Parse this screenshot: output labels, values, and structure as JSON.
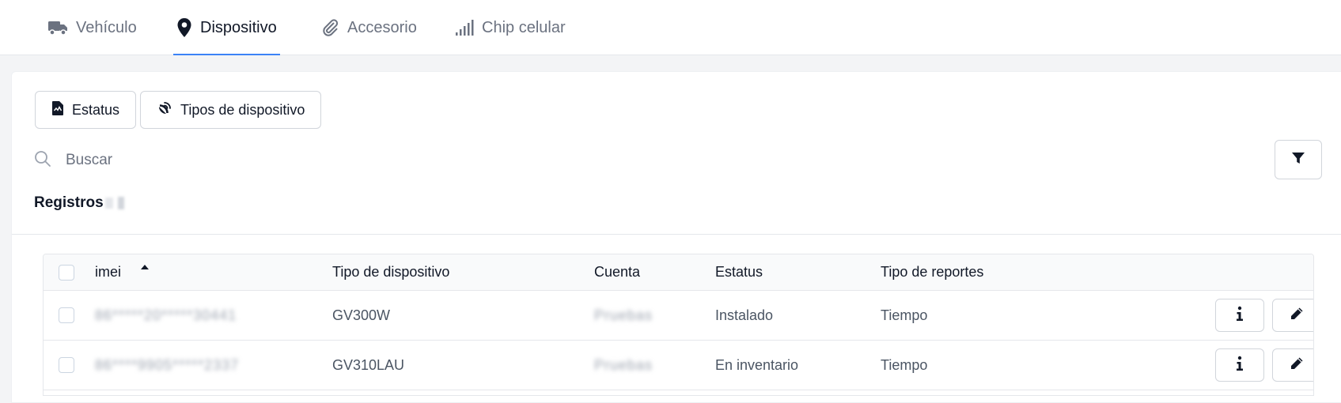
{
  "tabs": [
    {
      "label": "Vehículo",
      "icon": "truck-icon",
      "active": false
    },
    {
      "label": "Dispositivo",
      "icon": "location-pin-icon",
      "active": true
    },
    {
      "label": "Accesorio",
      "icon": "paperclip-icon",
      "active": false
    },
    {
      "label": "Chip celular",
      "icon": "signal-bars-icon",
      "active": false
    }
  ],
  "toolbar": {
    "estatus_label": "Estatus",
    "tipos_label": "Tipos de dispositivo"
  },
  "search": {
    "placeholder": "Buscar"
  },
  "records": {
    "label": "Registros"
  },
  "table": {
    "columns": [
      "imei",
      "Tipo de dispositivo",
      "Cuenta",
      "Estatus",
      "Tipo de reportes"
    ],
    "sort_column": "imei",
    "sort_direction": "ascending",
    "rows": [
      {
        "imei": "86*****20*****30441",
        "tipo": "GV300W",
        "cuenta": "Pruebas",
        "estatus": "Instalado",
        "reportes": "Tiempo"
      },
      {
        "imei": "86****9905*****2337",
        "tipo": "GV310LAU",
        "cuenta": "Pruebas",
        "estatus": "En inventario",
        "reportes": "Tiempo"
      }
    ]
  },
  "colors": {
    "accent": "#3b82f6",
    "text": "#111827",
    "muted": "#6b7280",
    "border": "#d1d5db"
  }
}
